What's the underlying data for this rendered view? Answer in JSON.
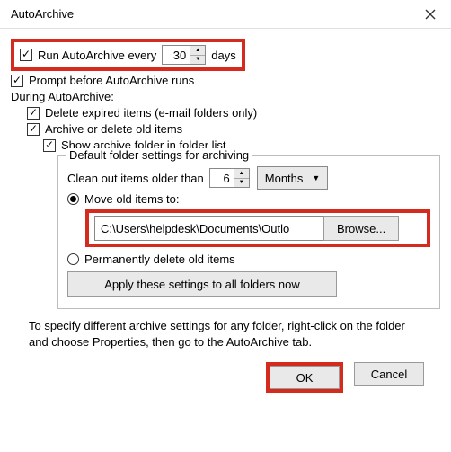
{
  "title": "AutoArchive",
  "run": {
    "label_prefix": "Run AutoArchive every",
    "value": "30",
    "label_suffix": "days",
    "checked": true
  },
  "prompt": {
    "label": "Prompt before AutoArchive runs",
    "checked": true
  },
  "during_label": "During AutoArchive:",
  "delete_expired": {
    "label": "Delete expired items (e-mail folders only)",
    "checked": true
  },
  "archive_old": {
    "label": "Archive or delete old items",
    "checked": true
  },
  "show_folder": {
    "label": "Show archive folder in folder list",
    "checked": true
  },
  "fieldset": {
    "legend": "Default folder settings for archiving",
    "cleanout_label": "Clean out items older than",
    "cleanout_value": "6",
    "cleanout_unit": "Months",
    "move_label": "Move old items to:",
    "move_checked": true,
    "path": "C:\\Users\\helpdesk\\Documents\\Outlo",
    "browse_label": "Browse...",
    "perm_label": "Permanently delete old items",
    "perm_checked": false,
    "apply_label": "Apply these settings to all folders now"
  },
  "info_text": "To specify different archive settings for any folder, right-click on the folder and choose Properties, then go to the AutoArchive tab.",
  "buttons": {
    "ok": "OK",
    "cancel": "Cancel"
  }
}
